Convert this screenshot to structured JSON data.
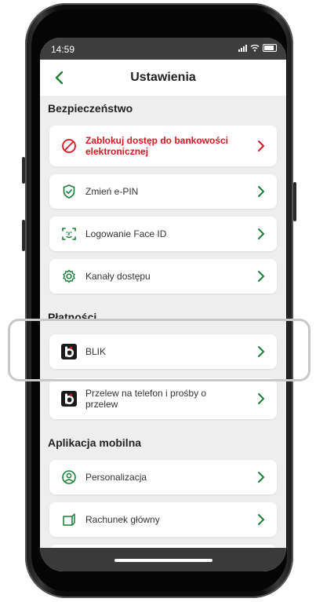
{
  "status_bar": {
    "time": "14:59"
  },
  "header": {
    "title": "Ustawienia"
  },
  "sections": {
    "security": {
      "title": "Bezpieczeństwo",
      "items": [
        {
          "label": "Zablokuj dostęp do bankowości elektronicznej",
          "icon": "block-icon"
        },
        {
          "label": "Zmień e-PIN",
          "icon": "shield-icon"
        },
        {
          "label": "Logowanie Face ID",
          "icon": "face-id-icon"
        },
        {
          "label": "Kanały dostępu",
          "icon": "gear-icon"
        }
      ]
    },
    "payments": {
      "title": "Płatności",
      "items": [
        {
          "label": "BLIK",
          "icon": "blik-icon"
        },
        {
          "label": "Przelew na telefon i prośby o przelew",
          "icon": "blik-icon"
        }
      ]
    },
    "mobile_app": {
      "title": "Aplikacja mobilna",
      "items": [
        {
          "label": "Personalizacja",
          "icon": "user-icon"
        },
        {
          "label": "Rachunek główny",
          "icon": "account-icon"
        }
      ]
    }
  },
  "colors": {
    "accent": "#1a7f37",
    "danger": "#e0141e",
    "highlight": "#c8c8c8"
  }
}
